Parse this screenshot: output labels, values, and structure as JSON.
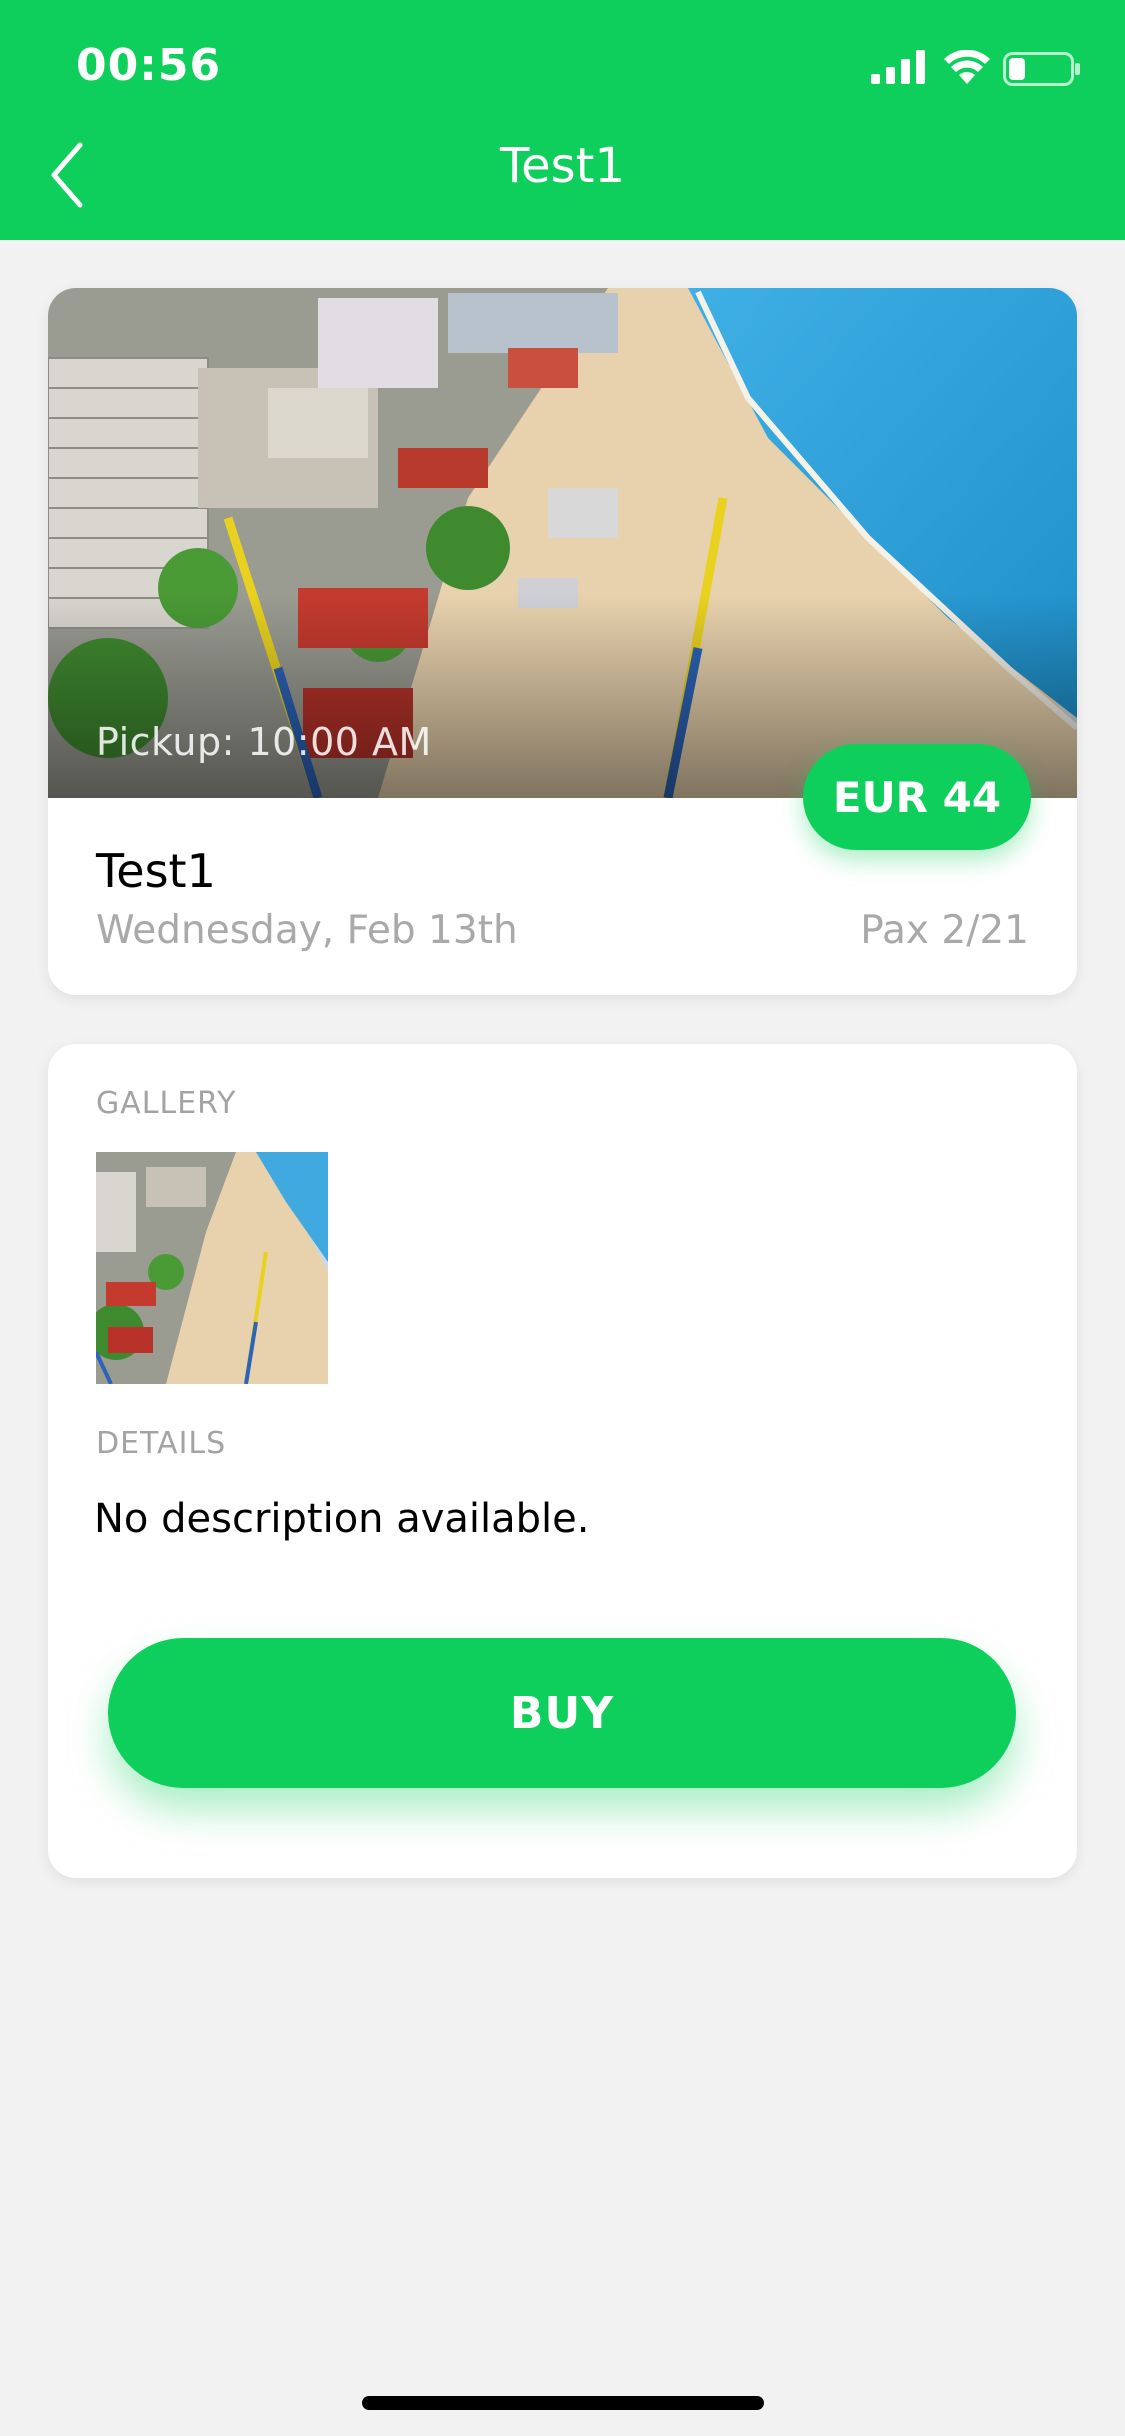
{
  "status_bar": {
    "time": "00:56",
    "icons": [
      "signal-icon",
      "wifi-icon",
      "battery-icon"
    ]
  },
  "header": {
    "title": "Test1",
    "back_icon": "chevron-left-icon",
    "background_color": "#0ecf5c"
  },
  "trip": {
    "image": "beach-resort-aerial-photo",
    "pickup": "Pickup: 10:00 AM",
    "price": "EUR 44",
    "title": "Test1",
    "date": "Wednesday, Feb 13th",
    "pax": "Pax 2/21"
  },
  "details_card": {
    "gallery_label": "GALLERY",
    "gallery_images": [
      "beach-resort-aerial-thumbnail"
    ],
    "details_label": "DETAILS",
    "description": "No description available.",
    "buy_label": "BUY"
  },
  "colors": {
    "accent": "#0ecf5c",
    "background": "#f2f2f2",
    "muted_text": "#a9a9a9"
  }
}
